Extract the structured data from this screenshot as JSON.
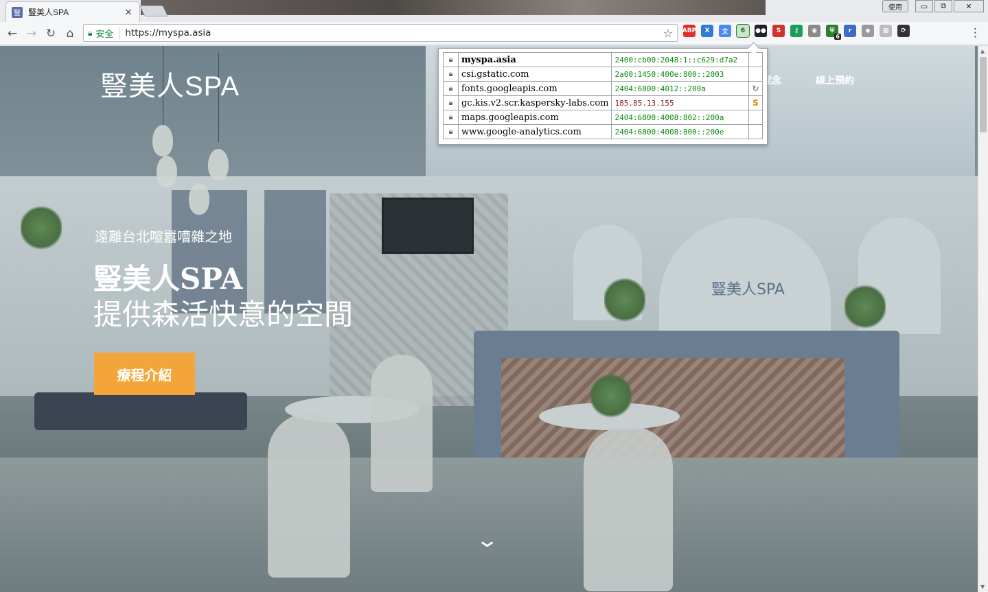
{
  "browser": {
    "tab_favicon": "豎",
    "tab_title": "豎美人SPA",
    "tab_close": "×",
    "user_button": "使用",
    "win_minimize": "▭",
    "win_restore": "⧉",
    "win_close": "✕",
    "back_icon": "←",
    "forward_icon": "→",
    "reload_icon": "↻",
    "home_icon": "⌂",
    "secure_label": "安全",
    "url": "https://myspa.asia",
    "star_icon": "☆",
    "menu_icon": "⋮",
    "extensions": [
      {
        "name": "adblock-icon",
        "text": "ABP",
        "color": "#e32b2b"
      },
      {
        "name": "translate-x-icon",
        "text": "X",
        "color": "#2f7cd6"
      },
      {
        "name": "google-translate-icon",
        "text": "文",
        "color": "#4a8af4"
      },
      {
        "name": "ipv6-indicator-icon",
        "text": "6",
        "color": "#2e7d32"
      },
      {
        "name": "tampermonkey-icon",
        "text": "●●",
        "color": "#222222"
      },
      {
        "name": "s-extension-icon",
        "text": "S",
        "color": "#d0332d"
      },
      {
        "name": "key-icon",
        "text": "⚷",
        "color": "#1b9e5a"
      },
      {
        "name": "globe-icon",
        "text": "◉",
        "color": "#8a8a8a"
      },
      {
        "name": "shield-extension-icon",
        "text": "⛨",
        "color": "#2e7d32"
      },
      {
        "name": "r-extension-icon",
        "text": "r",
        "color": "#3a6fc4"
      },
      {
        "name": "cube-extension-icon",
        "text": "◆",
        "color": "#9a9a9a"
      },
      {
        "name": "grid-extension-icon",
        "text": "▦",
        "color": "#bdbdbd"
      },
      {
        "name": "sync-extension-icon",
        "text": "⟳",
        "color": "#333333"
      }
    ],
    "shield_badge": "6"
  },
  "site": {
    "logo": "豎美人SPA",
    "nav": [
      "理念",
      "線上預約"
    ],
    "hero_subtitle": "遠離台北喧囂嘈雜之地",
    "hero_title_line1": "豎美人SPA",
    "hero_title_line2": "提供森活快意的空間",
    "cta_label": "療程介紹",
    "scroll_icon": "⌄",
    "wall_logo": "豎美人SPA"
  },
  "ip_popup": {
    "rows": [
      {
        "host": "myspa.asia",
        "addr": "2400:cb00:2048:1::c629:d7a2",
        "flag": "",
        "main": true
      },
      {
        "host": "csi.gstatic.com",
        "addr": "2a00:1450:400e:800::2003",
        "flag": ""
      },
      {
        "host": "fonts.googleapis.com",
        "addr": "2404:6800:4012::200a",
        "flag": "↻"
      },
      {
        "host": "gc.kis.v2.scr.kaspersky-labs.com",
        "addr": "185.85.13.155",
        "flag": "S",
        "v4": true
      },
      {
        "host": "maps.googleapis.com",
        "addr": "2404:6800:4008:802::200a",
        "flag": ""
      },
      {
        "host": "www.google-analytics.com",
        "addr": "2404:6800:4008:800::200e",
        "flag": ""
      }
    ]
  },
  "colors": {
    "cta": "#f4a53a",
    "secure": "#0b8043",
    "ipv6": "#0a8a0a"
  }
}
